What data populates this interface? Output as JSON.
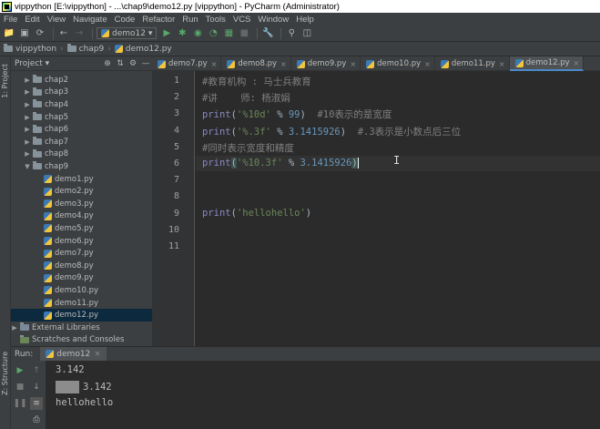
{
  "window": {
    "title": "vippython [E:\\vippython] - ...\\chap9\\demo12.py [vippython] - PyCharm (Administrator)"
  },
  "menu": [
    "File",
    "Edit",
    "View",
    "Navigate",
    "Code",
    "Refactor",
    "Run",
    "Tools",
    "VCS",
    "Window",
    "Help"
  ],
  "toolbar": {
    "run_config": "demo12 ▾"
  },
  "breadcrumb": [
    "vippython",
    "chap9",
    "demo12.py"
  ],
  "project": {
    "stripe_label": "1: Project",
    "title": "Project ▾",
    "tree": [
      {
        "label": "chap2",
        "kind": "folder",
        "depth": 1,
        "open": false
      },
      {
        "label": "chap3",
        "kind": "folder",
        "depth": 1,
        "open": false
      },
      {
        "label": "chap4",
        "kind": "folder",
        "depth": 1,
        "open": false
      },
      {
        "label": "chap5",
        "kind": "folder",
        "depth": 1,
        "open": false
      },
      {
        "label": "chap6",
        "kind": "folder",
        "depth": 1,
        "open": false
      },
      {
        "label": "chap7",
        "kind": "folder",
        "depth": 1,
        "open": false
      },
      {
        "label": "chap8",
        "kind": "folder",
        "depth": 1,
        "open": false
      },
      {
        "label": "chap9",
        "kind": "folder",
        "depth": 1,
        "open": true
      },
      {
        "label": "demo1.py",
        "kind": "py",
        "depth": 2
      },
      {
        "label": "demo2.py",
        "kind": "py",
        "depth": 2
      },
      {
        "label": "demo3.py",
        "kind": "py",
        "depth": 2
      },
      {
        "label": "demo4.py",
        "kind": "py",
        "depth": 2
      },
      {
        "label": "demo5.py",
        "kind": "py",
        "depth": 2
      },
      {
        "label": "demo6.py",
        "kind": "py",
        "depth": 2
      },
      {
        "label": "demo7.py",
        "kind": "py",
        "depth": 2
      },
      {
        "label": "demo8.py",
        "kind": "py",
        "depth": 2
      },
      {
        "label": "demo9.py",
        "kind": "py",
        "depth": 2
      },
      {
        "label": "demo10.py",
        "kind": "py",
        "depth": 2
      },
      {
        "label": "demo11.py",
        "kind": "py",
        "depth": 2
      },
      {
        "label": "demo12.py",
        "kind": "py",
        "depth": 2,
        "selected": true
      },
      {
        "label": "External Libraries",
        "kind": "lib",
        "depth": 0,
        "open": false
      },
      {
        "label": "Scratches and Consoles",
        "kind": "scratch",
        "depth": 0
      }
    ]
  },
  "tabs": [
    {
      "label": "demo7.py",
      "active": false
    },
    {
      "label": "demo8.py",
      "active": false
    },
    {
      "label": "demo9.py",
      "active": false
    },
    {
      "label": "demo10.py",
      "active": false
    },
    {
      "label": "demo11.py",
      "active": false
    },
    {
      "label": "demo12.py",
      "active": true
    }
  ],
  "editor": {
    "line_numbers": [
      "1",
      "2",
      "3",
      "4",
      "5",
      "6",
      "7",
      "8",
      "9",
      "10",
      "11"
    ],
    "lines": [
      [
        {
          "t": "#教育机构 : 马士兵教育",
          "c": "cmt"
        }
      ],
      [
        {
          "t": "#讲    师: 杨淑娟",
          "c": "cmt"
        }
      ],
      [
        {
          "t": "print",
          "c": "kw"
        },
        {
          "t": "(",
          "c": "op"
        },
        {
          "t": "'%10d'",
          "c": "str"
        },
        {
          "t": " % ",
          "c": "op"
        },
        {
          "t": "99",
          "c": "num"
        },
        {
          "t": ")  ",
          "c": "op"
        },
        {
          "t": "#10表示的是宽度",
          "c": "cmt"
        }
      ],
      [
        {
          "t": "print",
          "c": "kw"
        },
        {
          "t": "(",
          "c": "op"
        },
        {
          "t": "'%.3f'",
          "c": "str"
        },
        {
          "t": " % ",
          "c": "op"
        },
        {
          "t": "3.1415926",
          "c": "num"
        },
        {
          "t": ")  ",
          "c": "op"
        },
        {
          "t": "#.3表示是小数点后三位",
          "c": "cmt"
        }
      ],
      [
        {
          "t": "#同时表示宽度和精度",
          "c": "cmt"
        }
      ],
      [
        {
          "t": "print",
          "c": "kw"
        },
        {
          "t": "(",
          "c": "op hl"
        },
        {
          "t": "'%10.3f'",
          "c": "str"
        },
        {
          "t": " % ",
          "c": "op"
        },
        {
          "t": "3.1415926",
          "c": "num"
        },
        {
          "t": ")",
          "c": "op hl"
        }
      ],
      [],
      [],
      [
        {
          "t": "print",
          "c": "kw"
        },
        {
          "t": "(",
          "c": "op"
        },
        {
          "t": "'hellohello'",
          "c": "str"
        },
        {
          "t": ")",
          "c": "op"
        }
      ],
      [],
      []
    ]
  },
  "run": {
    "label": "Run:",
    "tab": "demo12",
    "stripe_label": "Z: Structure",
    "output": [
      "3.142",
      "3.142",
      "hellohello"
    ]
  }
}
